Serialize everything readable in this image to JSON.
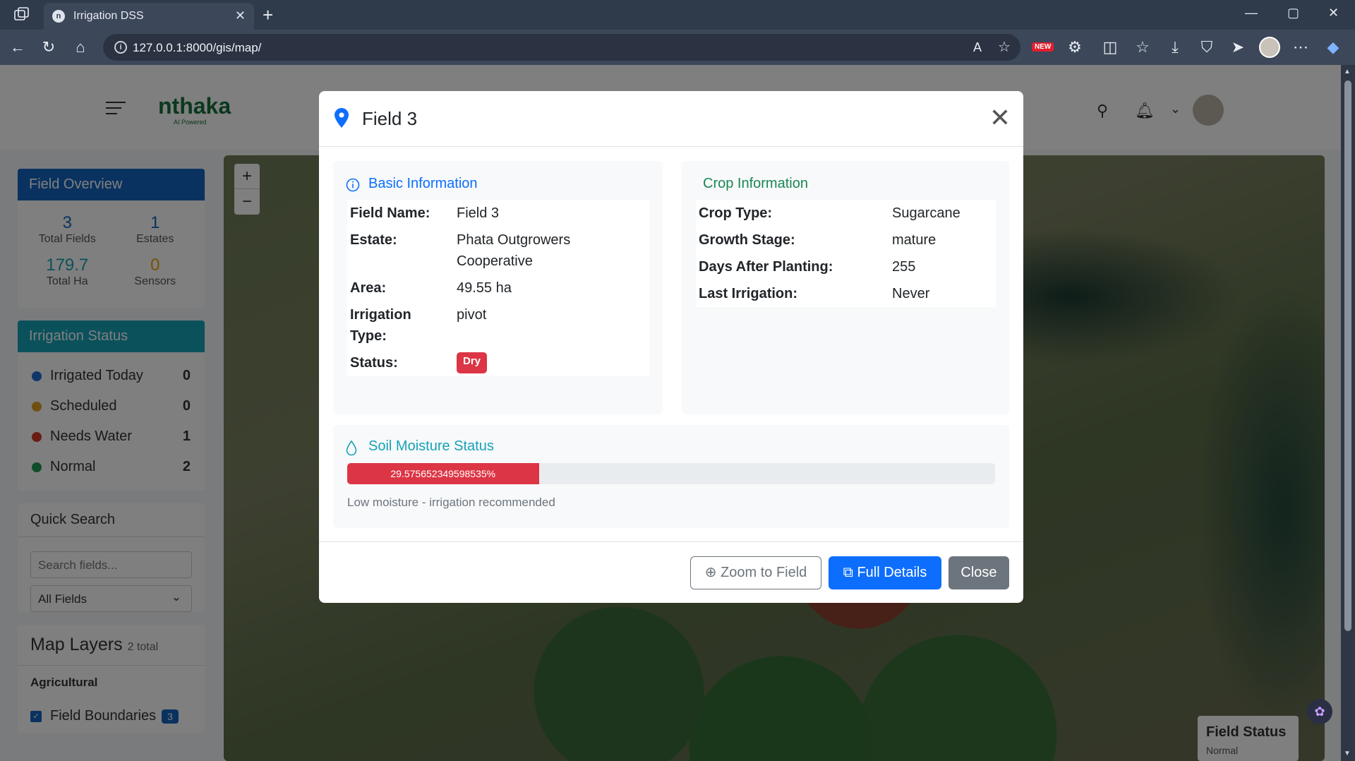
{
  "browser": {
    "tab_title": "Irrigation DSS",
    "url": "127.0.0.1:8000/gis/map/",
    "new_badge": "NEW",
    "window_controls": {
      "minimize": "—",
      "maximize": "▢",
      "close": "✕"
    }
  },
  "app": {
    "logo": "nthaka",
    "logo_sub": "AI Powered"
  },
  "sidebar": {
    "overview": {
      "title": "Field Overview",
      "stats": [
        {
          "value": "3",
          "label": "Total Fields",
          "color": "#1565c0"
        },
        {
          "value": "1",
          "label": "Estates",
          "color": "#1565c0"
        },
        {
          "value": "179.7",
          "label": "Total Ha",
          "color": "#17a2b8"
        },
        {
          "value": "0",
          "label": "Sensors",
          "color": "#f0a500"
        }
      ]
    },
    "irrigation": {
      "title": "Irrigation Status",
      "rows": [
        {
          "label": "Irrigated Today",
          "count": "0",
          "color": "#1f6fd6"
        },
        {
          "label": "Scheduled",
          "count": "0",
          "color": "#e0a020"
        },
        {
          "label": "Needs Water",
          "count": "1",
          "color": "#d43b2a"
        },
        {
          "label": "Normal",
          "count": "2",
          "color": "#1f9d55"
        }
      ]
    },
    "quick_search": {
      "title": "Quick Search",
      "placeholder": "Search fields...",
      "filter_value": "All Fields"
    },
    "layers": {
      "title": "Map Layers",
      "total": "2 total",
      "group": "Agricultural",
      "items": [
        {
          "label": "Field Boundaries",
          "count": "3"
        }
      ]
    }
  },
  "map": {
    "zoom_in": "+",
    "zoom_out": "−",
    "legend_title": "Field Status",
    "legend_item": "Normal"
  },
  "modal": {
    "title": "Field 3",
    "basic": {
      "title": "Basic Information",
      "rows": [
        {
          "key": "Field Name:",
          "value": "Field 3"
        },
        {
          "key": "Estate:",
          "value": "Phata Outgrowers Cooperative"
        },
        {
          "key": "Area:",
          "value": "49.55 ha"
        },
        {
          "key": "Irrigation Type:",
          "value": "pivot"
        }
      ],
      "status_key": "Status:",
      "status_value": "Dry"
    },
    "crop": {
      "title": "Crop Information",
      "rows": [
        {
          "key": "Crop Type:",
          "value": "Sugarcane"
        },
        {
          "key": "Growth Stage:",
          "value": "mature"
        },
        {
          "key": "Days After Planting:",
          "value": "255"
        },
        {
          "key": "Last Irrigation:",
          "value": "Never"
        }
      ]
    },
    "soil": {
      "title": "Soil Moisture Status",
      "percent_label": "29.575652349598535%",
      "percent": 29.575652349598535,
      "note": "Low moisture - irrigation recommended"
    },
    "buttons": {
      "zoom": "Zoom to Field",
      "details": "Full Details",
      "close": "Close"
    }
  },
  "colors": {
    "primary": "#0d6efd",
    "danger": "#dc3545",
    "info": "#17a2b8",
    "success_text": "#198754"
  }
}
